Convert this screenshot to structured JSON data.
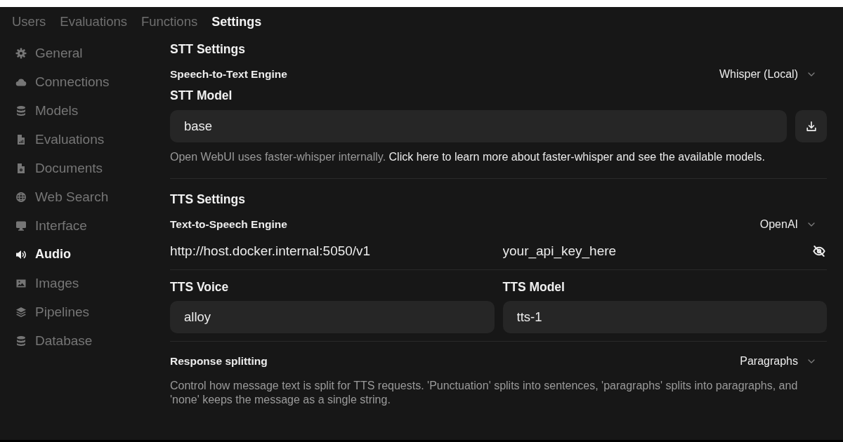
{
  "top_tabs": [
    {
      "label": "Users",
      "selected": false
    },
    {
      "label": "Evaluations",
      "selected": false
    },
    {
      "label": "Functions",
      "selected": false
    },
    {
      "label": "Settings",
      "selected": true
    }
  ],
  "sidebar": {
    "items": [
      {
        "label": "General",
        "selected": false
      },
      {
        "label": "Connections",
        "selected": false
      },
      {
        "label": "Models",
        "selected": false
      },
      {
        "label": "Evaluations",
        "selected": false
      },
      {
        "label": "Documents",
        "selected": false
      },
      {
        "label": "Web Search",
        "selected": false
      },
      {
        "label": "Interface",
        "selected": false
      },
      {
        "label": "Audio",
        "selected": true
      },
      {
        "label": "Images",
        "selected": false
      },
      {
        "label": "Pipelines",
        "selected": false
      },
      {
        "label": "Database",
        "selected": false
      }
    ]
  },
  "stt_settings": {
    "title": "STT Settings",
    "engine": {
      "label": "Speech-to-Text Engine",
      "value": "Whisper (Local)"
    },
    "model": {
      "label": "STT Model",
      "value": "base"
    },
    "help": {
      "text": "Open WebUI uses faster-whisper internally.",
      "link": "Click here to learn more about faster-whisper and see the available models."
    }
  },
  "tts_settings": {
    "title": "TTS Settings",
    "engine": {
      "label": "Text-to-Speech Engine",
      "value": "OpenAI"
    },
    "api_base_url": {
      "value": "http://host.docker.internal:5050/v1"
    },
    "api_key": {
      "value": "your_api_key_here",
      "visible": true
    },
    "voice": {
      "label": "TTS Voice",
      "value": "alloy"
    },
    "model": {
      "label": "TTS Model",
      "value": "tts-1"
    }
  },
  "response_splitting": {
    "label": "Response splitting",
    "value": "Paragraphs",
    "description": "Control how message text is split for TTS requests. 'Punctuation' splits into sentences, 'paragraphs' splits into paragraphs, and 'none' keeps the message as a single string."
  }
}
